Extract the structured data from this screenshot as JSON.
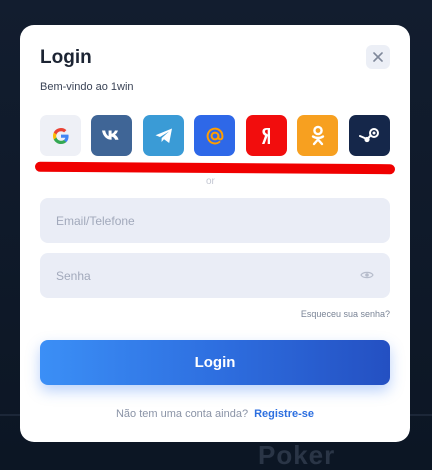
{
  "background": {
    "text": "Poker"
  },
  "modal": {
    "title": "Login",
    "subtitle": "Bem-vindo ao 1win",
    "close_icon": "close-icon"
  },
  "social": [
    {
      "name": "google",
      "icon": "google-icon",
      "bg": "#eef0f6"
    },
    {
      "name": "vk",
      "icon": "vk-icon",
      "bg": "#3f6596"
    },
    {
      "name": "telegram",
      "icon": "telegram-icon",
      "bg": "#3a9bd6"
    },
    {
      "name": "mailru",
      "icon": "mail-at-icon",
      "bg": "#2e68e8"
    },
    {
      "name": "yandex",
      "icon": "yandex-icon",
      "bg": "#f20d0d"
    },
    {
      "name": "odnoklassniki",
      "icon": "ok-icon",
      "bg": "#f7a020"
    },
    {
      "name": "steam",
      "icon": "steam-icon",
      "bg": "#15274a"
    }
  ],
  "divider_text": "or",
  "form": {
    "email_placeholder": "Email/Telefone",
    "password_placeholder": "Senha",
    "forgot_label": "Esqueceu sua senha?",
    "login_label": "Login"
  },
  "footer": {
    "question": "Não tem uma conta ainda?",
    "register_label": "Registre-se"
  },
  "colors": {
    "accent": "#2e6fe0",
    "annotation_red": "#f00000"
  }
}
